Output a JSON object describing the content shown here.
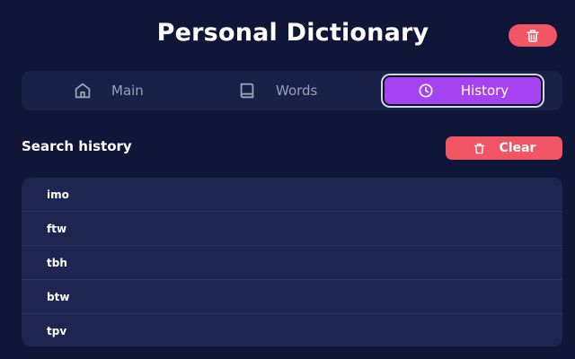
{
  "header": {
    "title": "Personal Dictionary",
    "delete_icon": "trash-icon"
  },
  "nav": {
    "tabs": [
      {
        "label": "Main",
        "icon": "home-icon"
      },
      {
        "label": "Words",
        "icon": "book-icon"
      },
      {
        "label": "History",
        "icon": "clock-icon",
        "active": true
      }
    ]
  },
  "history": {
    "title": "Search history",
    "clear_label": "Clear",
    "clear_icon": "trash-icon",
    "items": [
      "imo",
      "ftw",
      "tbh",
      "btw",
      "tpv"
    ]
  },
  "colors": {
    "background": "#0f1638",
    "panel": "#182148",
    "list_background": "#1d2550",
    "accent": "#a543f2",
    "danger": "#f25564",
    "muted_text": "#9aa1b8"
  }
}
